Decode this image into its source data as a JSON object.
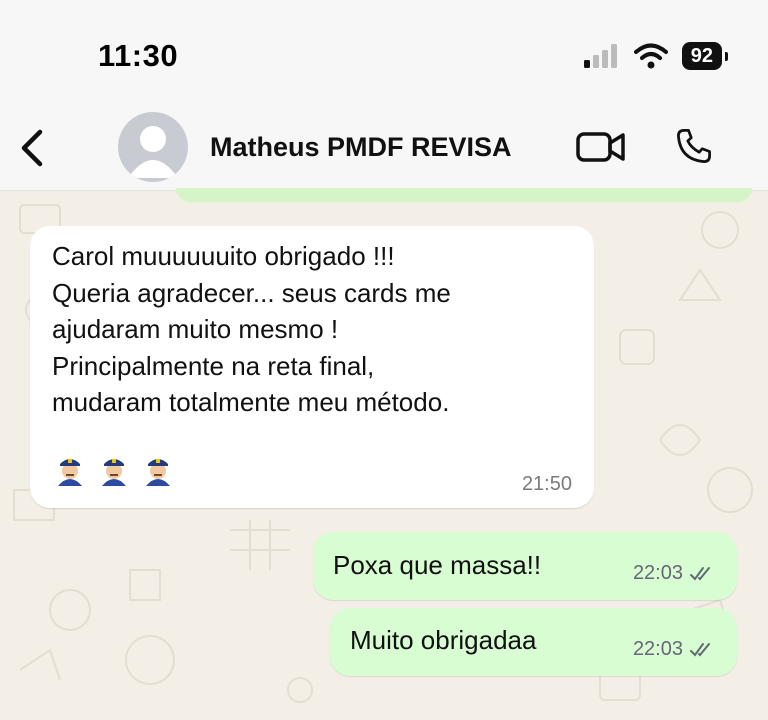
{
  "status_bar": {
    "time": "11:30",
    "battery": "92",
    "signal_icon": "cellular-signal-icon",
    "wifi_icon": "wifi-icon"
  },
  "header": {
    "back_icon": "chevron-left-icon",
    "contact_name": "Matheus PMDF REVISA",
    "video_icon": "video-camera-icon",
    "call_icon": "phone-icon"
  },
  "messages": [
    {
      "direction": "incoming",
      "lines": [
        "Carol muuuuuuito obrigado !!!",
        "Queria agradecer... seus cards me",
        "ajudaram muito mesmo !",
        "Principalmente na reta final,",
        "mudaram totalmente meu método."
      ],
      "emoji": "👮🏼 👮🏼 👮🏼",
      "time": "21:50"
    },
    {
      "direction": "outgoing",
      "text": "Poxa que massa!!",
      "time": "22:03",
      "status_icon": "double-check-icon"
    },
    {
      "direction": "outgoing",
      "text": "Muito obrigadaa",
      "time": "22:03",
      "status_icon": "double-check-icon"
    }
  ],
  "colors": {
    "chat_background": "#f3efe7",
    "incoming_bubble": "#ffffff",
    "outgoing_bubble": "#d9fdd3",
    "bar_background": "#f7f7f7"
  }
}
